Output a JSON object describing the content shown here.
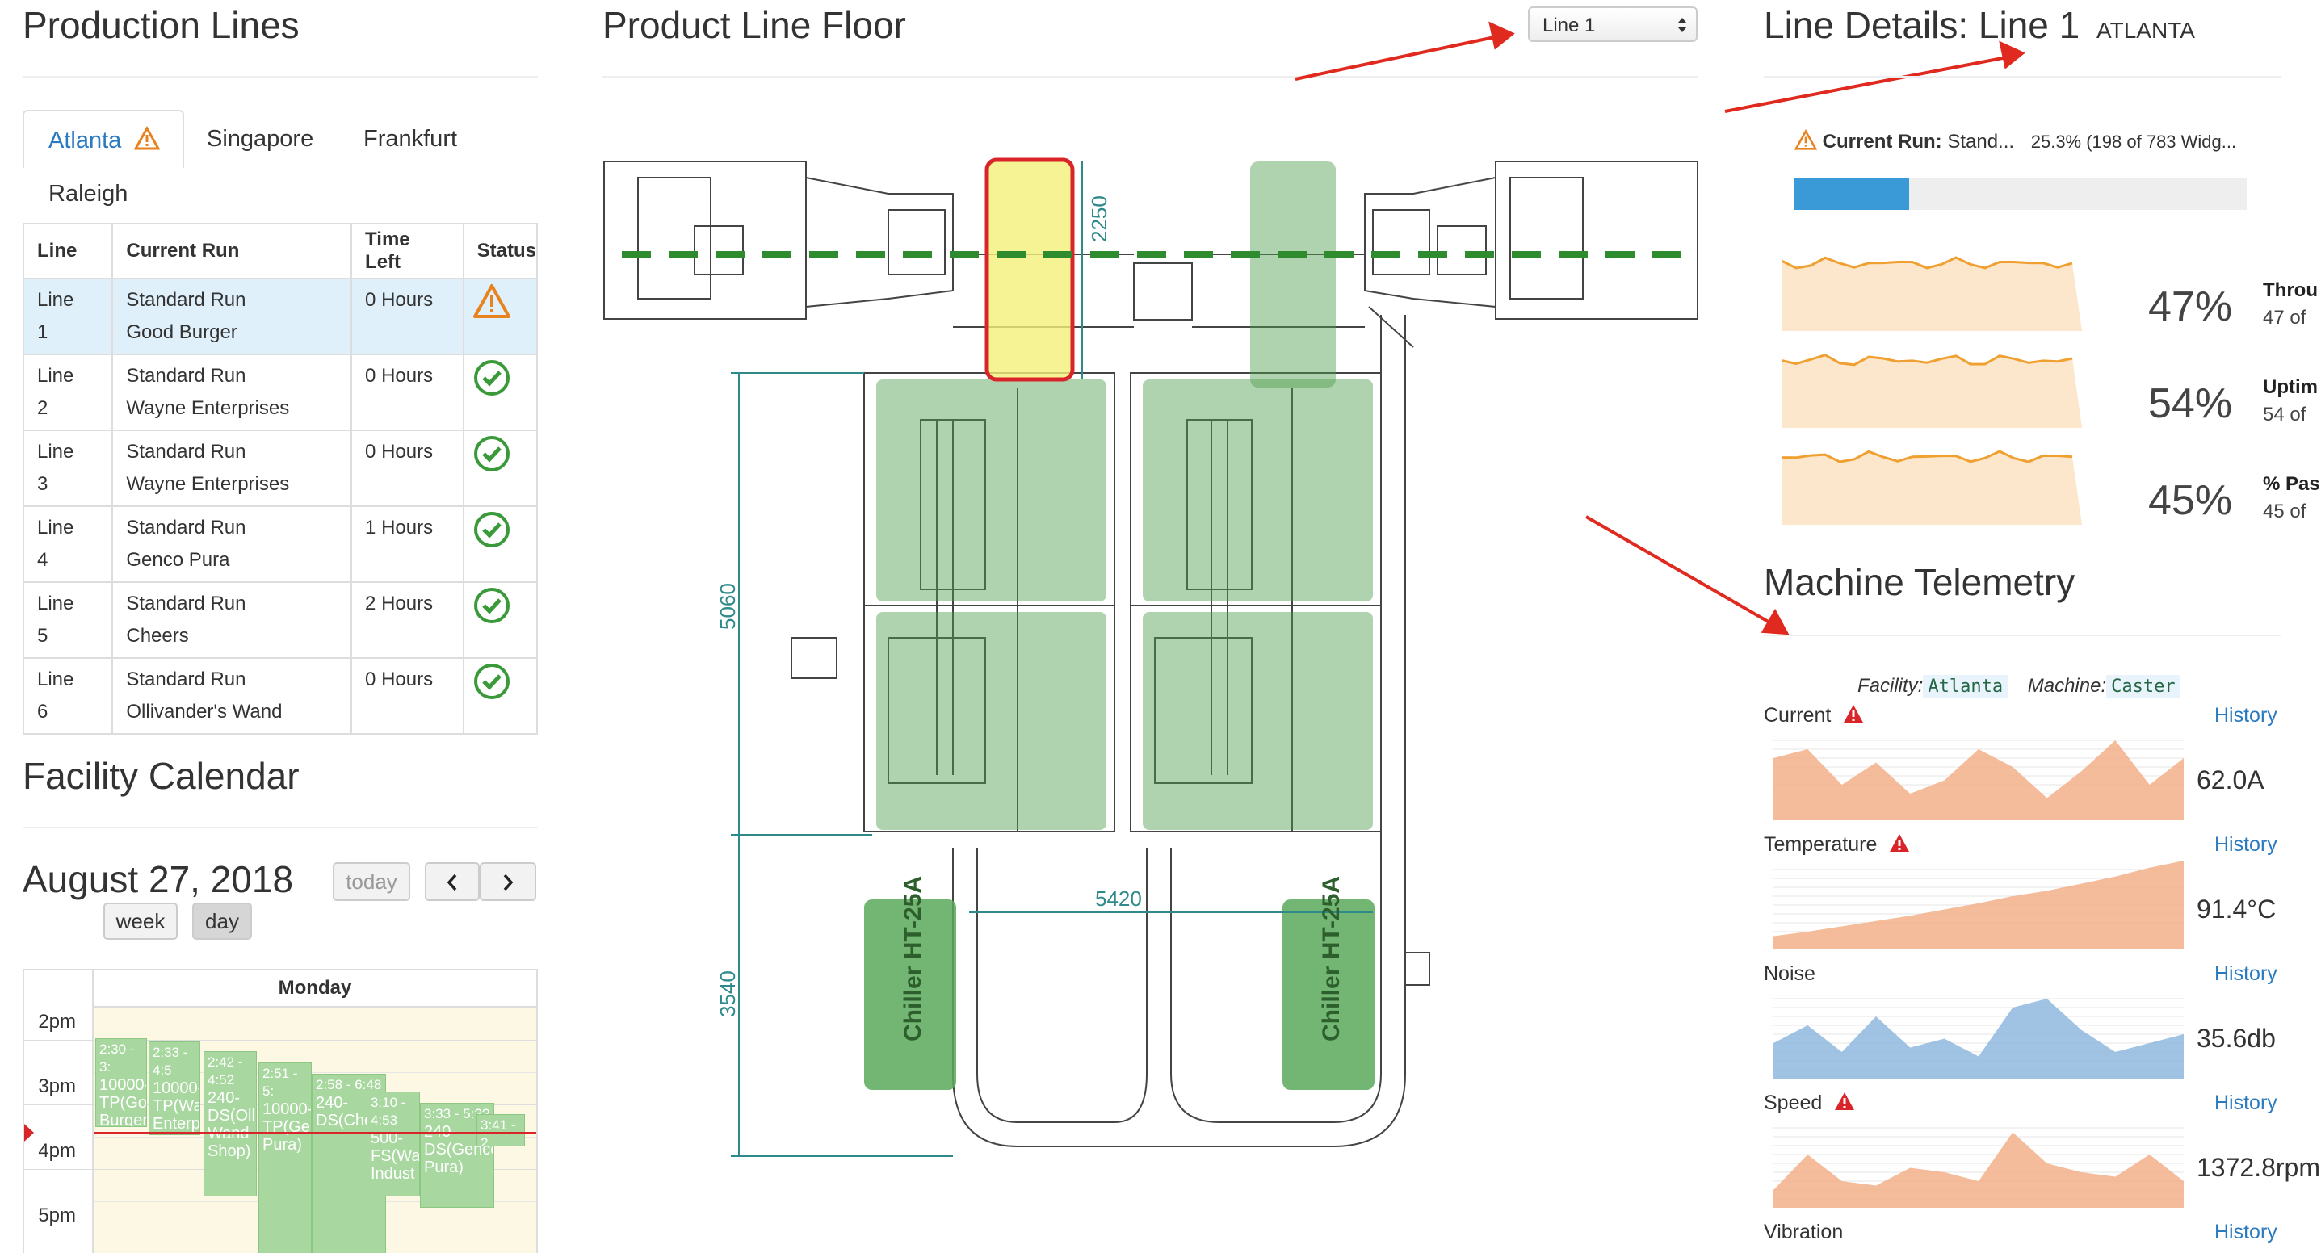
{
  "left": {
    "title": "Production Lines",
    "tabs": [
      "Atlanta",
      "Singapore",
      "Frankfurt",
      "Raleigh"
    ],
    "table": {
      "headers": [
        "Line",
        "Current Run",
        "Time Left",
        "Status"
      ],
      "rows": [
        {
          "line": "Line",
          "num": "1",
          "run": "Standard Run",
          "customer": "Good Burger",
          "time": "0 Hours",
          "status": "warning"
        },
        {
          "line": "Line",
          "num": "2",
          "run": "Standard Run",
          "customer": "Wayne Enterprises",
          "time": "0 Hours",
          "status": "ok"
        },
        {
          "line": "Line",
          "num": "3",
          "run": "Standard Run",
          "customer": "Wayne Enterprises",
          "time": "0 Hours",
          "status": "ok"
        },
        {
          "line": "Line",
          "num": "4",
          "run": "Standard Run",
          "customer": "Genco Pura",
          "time": "1 Hours",
          "status": "ok"
        },
        {
          "line": "Line",
          "num": "5",
          "run": "Standard Run",
          "customer": "Cheers",
          "time": "2 Hours",
          "status": "ok"
        },
        {
          "line": "Line",
          "num": "6",
          "run": "Standard Run",
          "customer": "Ollivander's Wand",
          "time": "0 Hours",
          "status": "ok"
        }
      ]
    },
    "calendar": {
      "title": "Facility Calendar",
      "date": "August 27, 2018",
      "today": "today",
      "prev": "<",
      "next": ">",
      "week": "week",
      "day": "day",
      "day_header": "Monday",
      "times": [
        "2pm",
        "3pm",
        "4pm",
        "5pm"
      ],
      "events": [
        {
          "time": "2:30 - 3:",
          "text": "10000-TP(Goo Burger"
        },
        {
          "time": "2:33 - 4:5",
          "text": "10000-TP(Way Enterpr"
        },
        {
          "time": "2:42 - 4:52",
          "text": "240-DS(Olli Wand Shop)"
        },
        {
          "time": "2:51 - 5:",
          "text": "10000-TP(Ger Pura)"
        },
        {
          "time": "2:58 - 6:48",
          "text": "240-DS(Che"
        },
        {
          "time": "3:10 - 4:53",
          "text": "500-FS(Wa Indust"
        },
        {
          "time": "3:33 - 5:??",
          "text": "240-DS(Genco Pura)"
        },
        {
          "time": "3:41 - 2",
          "text": ""
        }
      ]
    }
  },
  "middle": {
    "title": "Product Line Floor",
    "select_value": "Line 1",
    "dims": [
      "2250",
      "5060",
      "5420",
      "3540"
    ],
    "chiller_label": "Chiller HT-25A"
  },
  "right": {
    "title": "Line Details: Line 1",
    "location": "ATLANTA",
    "current_run_label": "Current Run:",
    "current_run_value": "Stand...",
    "progress_text": "25.3% (198 of 783 Widg...",
    "progress": 0.253,
    "kpis": [
      {
        "pct": "47%",
        "label": "Throu",
        "sub": "47 of"
      },
      {
        "pct": "54%",
        "label": "Uptim",
        "sub": "54 of"
      },
      {
        "pct": "45%",
        "label": "% Pas",
        "sub": "45 of"
      }
    ],
    "telemetry": {
      "title": "Machine Telemetry",
      "facility_label": "Facility:",
      "facility": "Atlanta",
      "machine_label": "Machine:",
      "machine": "Caster",
      "history": "History",
      "rows": [
        {
          "label": "Current",
          "alert": true,
          "value": "62.0A"
        },
        {
          "label": "Temperature",
          "alert": true,
          "value": "91.4°C"
        },
        {
          "label": "Noise",
          "alert": false,
          "value": "35.6db"
        },
        {
          "label": "Speed",
          "alert": true,
          "value": "1372.8rpm"
        },
        {
          "label": "Vibration",
          "alert": false,
          "value": ""
        }
      ]
    }
  },
  "colors": {
    "accent": "#2a7ac0",
    "ok": "#3a9a3a",
    "warn": "#e8821e",
    "alert": "#d9252a",
    "green_zone": "#5aa85a",
    "yellow_zone": "#f4f07a"
  }
}
